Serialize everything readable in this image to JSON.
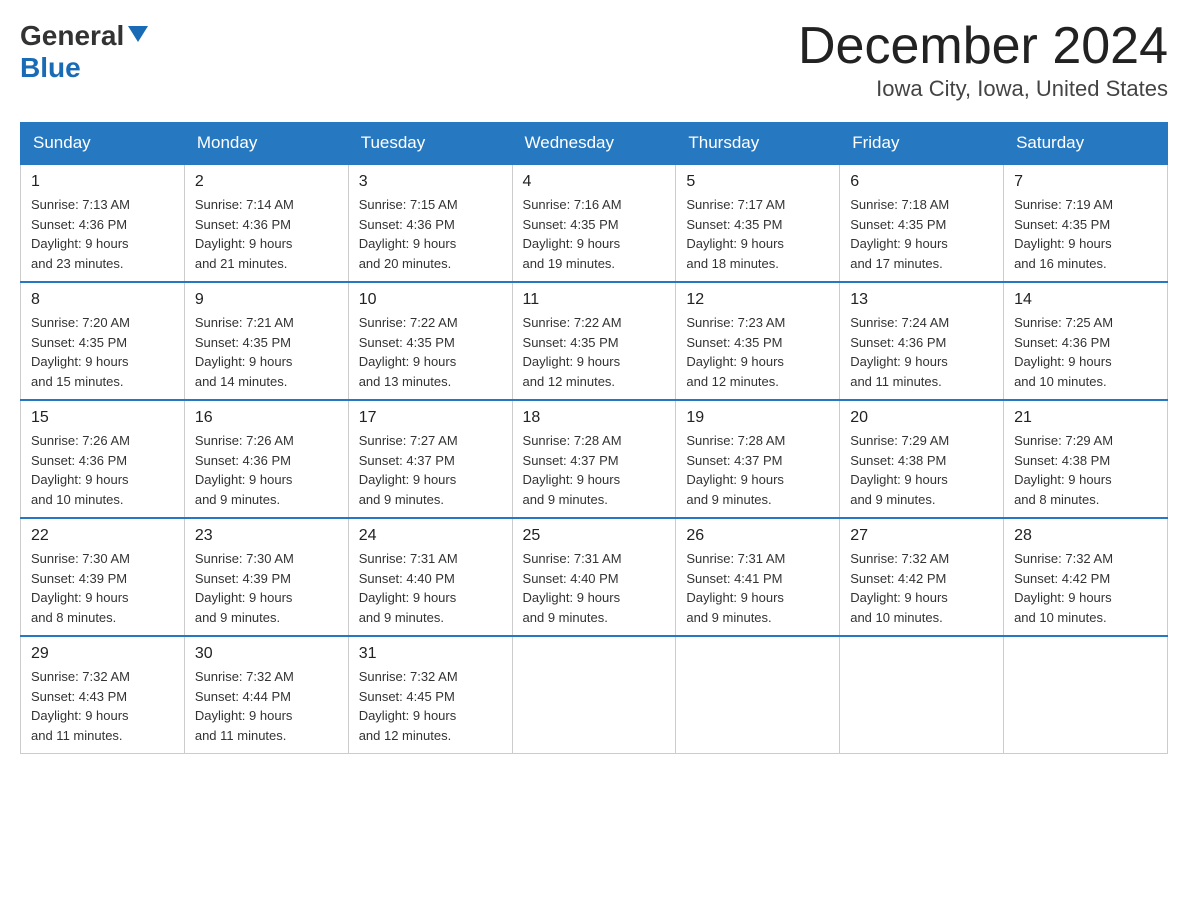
{
  "header": {
    "logo_line1": "General",
    "logo_line2": "Blue",
    "month_title": "December 2024",
    "location": "Iowa City, Iowa, United States"
  },
  "days_of_week": [
    "Sunday",
    "Monday",
    "Tuesday",
    "Wednesday",
    "Thursday",
    "Friday",
    "Saturday"
  ],
  "weeks": [
    [
      {
        "day": "1",
        "sunrise": "7:13 AM",
        "sunset": "4:36 PM",
        "daylight": "9 hours and 23 minutes."
      },
      {
        "day": "2",
        "sunrise": "7:14 AM",
        "sunset": "4:36 PM",
        "daylight": "9 hours and 21 minutes."
      },
      {
        "day": "3",
        "sunrise": "7:15 AM",
        "sunset": "4:36 PM",
        "daylight": "9 hours and 20 minutes."
      },
      {
        "day": "4",
        "sunrise": "7:16 AM",
        "sunset": "4:35 PM",
        "daylight": "9 hours and 19 minutes."
      },
      {
        "day": "5",
        "sunrise": "7:17 AM",
        "sunset": "4:35 PM",
        "daylight": "9 hours and 18 minutes."
      },
      {
        "day": "6",
        "sunrise": "7:18 AM",
        "sunset": "4:35 PM",
        "daylight": "9 hours and 17 minutes."
      },
      {
        "day": "7",
        "sunrise": "7:19 AM",
        "sunset": "4:35 PM",
        "daylight": "9 hours and 16 minutes."
      }
    ],
    [
      {
        "day": "8",
        "sunrise": "7:20 AM",
        "sunset": "4:35 PM",
        "daylight": "9 hours and 15 minutes."
      },
      {
        "day": "9",
        "sunrise": "7:21 AM",
        "sunset": "4:35 PM",
        "daylight": "9 hours and 14 minutes."
      },
      {
        "day": "10",
        "sunrise": "7:22 AM",
        "sunset": "4:35 PM",
        "daylight": "9 hours and 13 minutes."
      },
      {
        "day": "11",
        "sunrise": "7:22 AM",
        "sunset": "4:35 PM",
        "daylight": "9 hours and 12 minutes."
      },
      {
        "day": "12",
        "sunrise": "7:23 AM",
        "sunset": "4:35 PM",
        "daylight": "9 hours and 12 minutes."
      },
      {
        "day": "13",
        "sunrise": "7:24 AM",
        "sunset": "4:36 PM",
        "daylight": "9 hours and 11 minutes."
      },
      {
        "day": "14",
        "sunrise": "7:25 AM",
        "sunset": "4:36 PM",
        "daylight": "9 hours and 10 minutes."
      }
    ],
    [
      {
        "day": "15",
        "sunrise": "7:26 AM",
        "sunset": "4:36 PM",
        "daylight": "9 hours and 10 minutes."
      },
      {
        "day": "16",
        "sunrise": "7:26 AM",
        "sunset": "4:36 PM",
        "daylight": "9 hours and 9 minutes."
      },
      {
        "day": "17",
        "sunrise": "7:27 AM",
        "sunset": "4:37 PM",
        "daylight": "9 hours and 9 minutes."
      },
      {
        "day": "18",
        "sunrise": "7:28 AM",
        "sunset": "4:37 PM",
        "daylight": "9 hours and 9 minutes."
      },
      {
        "day": "19",
        "sunrise": "7:28 AM",
        "sunset": "4:37 PM",
        "daylight": "9 hours and 9 minutes."
      },
      {
        "day": "20",
        "sunrise": "7:29 AM",
        "sunset": "4:38 PM",
        "daylight": "9 hours and 9 minutes."
      },
      {
        "day": "21",
        "sunrise": "7:29 AM",
        "sunset": "4:38 PM",
        "daylight": "9 hours and 8 minutes."
      }
    ],
    [
      {
        "day": "22",
        "sunrise": "7:30 AM",
        "sunset": "4:39 PM",
        "daylight": "9 hours and 8 minutes."
      },
      {
        "day": "23",
        "sunrise": "7:30 AM",
        "sunset": "4:39 PM",
        "daylight": "9 hours and 9 minutes."
      },
      {
        "day": "24",
        "sunrise": "7:31 AM",
        "sunset": "4:40 PM",
        "daylight": "9 hours and 9 minutes."
      },
      {
        "day": "25",
        "sunrise": "7:31 AM",
        "sunset": "4:40 PM",
        "daylight": "9 hours and 9 minutes."
      },
      {
        "day": "26",
        "sunrise": "7:31 AM",
        "sunset": "4:41 PM",
        "daylight": "9 hours and 9 minutes."
      },
      {
        "day": "27",
        "sunrise": "7:32 AM",
        "sunset": "4:42 PM",
        "daylight": "9 hours and 10 minutes."
      },
      {
        "day": "28",
        "sunrise": "7:32 AM",
        "sunset": "4:42 PM",
        "daylight": "9 hours and 10 minutes."
      }
    ],
    [
      {
        "day": "29",
        "sunrise": "7:32 AM",
        "sunset": "4:43 PM",
        "daylight": "9 hours and 11 minutes."
      },
      {
        "day": "30",
        "sunrise": "7:32 AM",
        "sunset": "4:44 PM",
        "daylight": "9 hours and 11 minutes."
      },
      {
        "day": "31",
        "sunrise": "7:32 AM",
        "sunset": "4:45 PM",
        "daylight": "9 hours and 12 minutes."
      },
      null,
      null,
      null,
      null
    ]
  ],
  "labels": {
    "sunrise_prefix": "Sunrise: ",
    "sunset_prefix": "Sunset: ",
    "daylight_prefix": "Daylight: "
  }
}
